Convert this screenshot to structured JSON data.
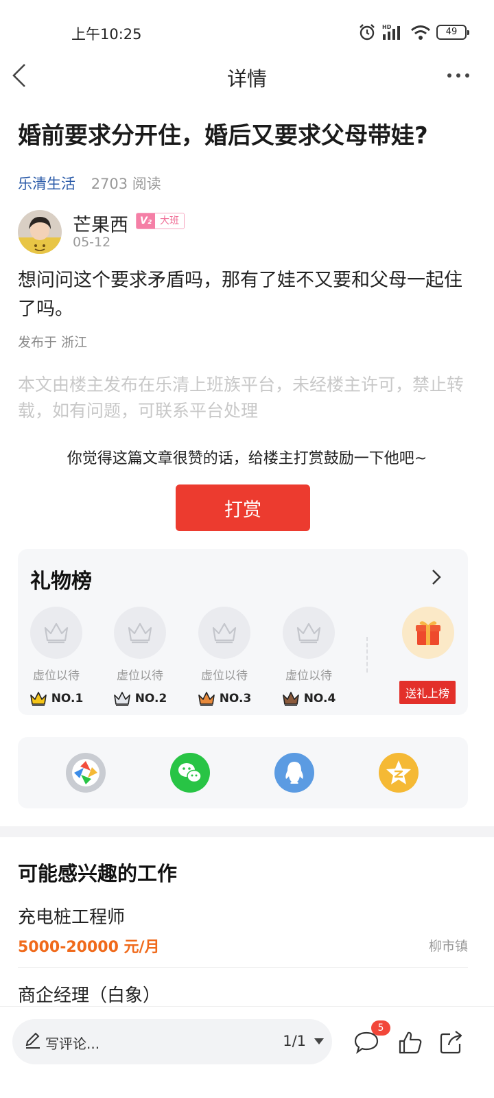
{
  "status_bar": {
    "time": "上午10:25",
    "battery": "49",
    "hd_label": "HD"
  },
  "nav": {
    "title": "详情"
  },
  "article": {
    "title": "婚前要求分开住，婚后又要求父母带娃?",
    "source": "乐清生活",
    "reads": "2703 阅读",
    "author": {
      "name": "芒果西",
      "vip_level": "V₂",
      "vip_text": "大班",
      "date": "05-12"
    },
    "body": "想问问这个要求矛盾吗，那有了娃不又要和父母一起住了吗。",
    "location": "发布于 浙江",
    "notice": "本文由楼主发布在乐清上班族平台，未经楼主许可，禁止转载，如有问题，可联系平台处理"
  },
  "reward": {
    "hint": "你觉得这篇文章很赞的话，给楼主打赏鼓励一下他吧~",
    "button": "打赏"
  },
  "gift_board": {
    "title": "礼物榜",
    "slots": [
      {
        "label": "虚位以待",
        "rank": "NO.1",
        "crown_color": "#f5c518"
      },
      {
        "label": "虚位以待",
        "rank": "NO.2",
        "crown_color": "#e3e6ec"
      },
      {
        "label": "虚位以待",
        "rank": "NO.3",
        "crown_color": "#e88a3c"
      },
      {
        "label": "虚位以待",
        "rank": "NO.4",
        "crown_color": "#8b5a3c"
      }
    ],
    "send_button": "送礼上榜"
  },
  "share": {
    "targets": [
      {
        "icon": "moments-icon",
        "color": "#c9ccd2"
      },
      {
        "icon": "wechat-icon",
        "color": "#28c445"
      },
      {
        "icon": "qq-icon",
        "color": "#5b9be2"
      },
      {
        "icon": "qzone-icon",
        "color": "#f5b935"
      }
    ]
  },
  "jobs": {
    "title": "可能感兴趣的工作",
    "items": [
      {
        "name": "充电桩工程师",
        "salary": "5000-20000 元/月",
        "location": "柳市镇"
      },
      {
        "name": "商企经理（白象）"
      }
    ]
  },
  "bottom_bar": {
    "comment_placeholder": "写评论...",
    "page": "1/1",
    "comment_count": "5"
  },
  "colors": {
    "accent_red": "#ec3b2f",
    "link_blue": "#2a5aa8",
    "salary_orange": "#f06a1b"
  }
}
